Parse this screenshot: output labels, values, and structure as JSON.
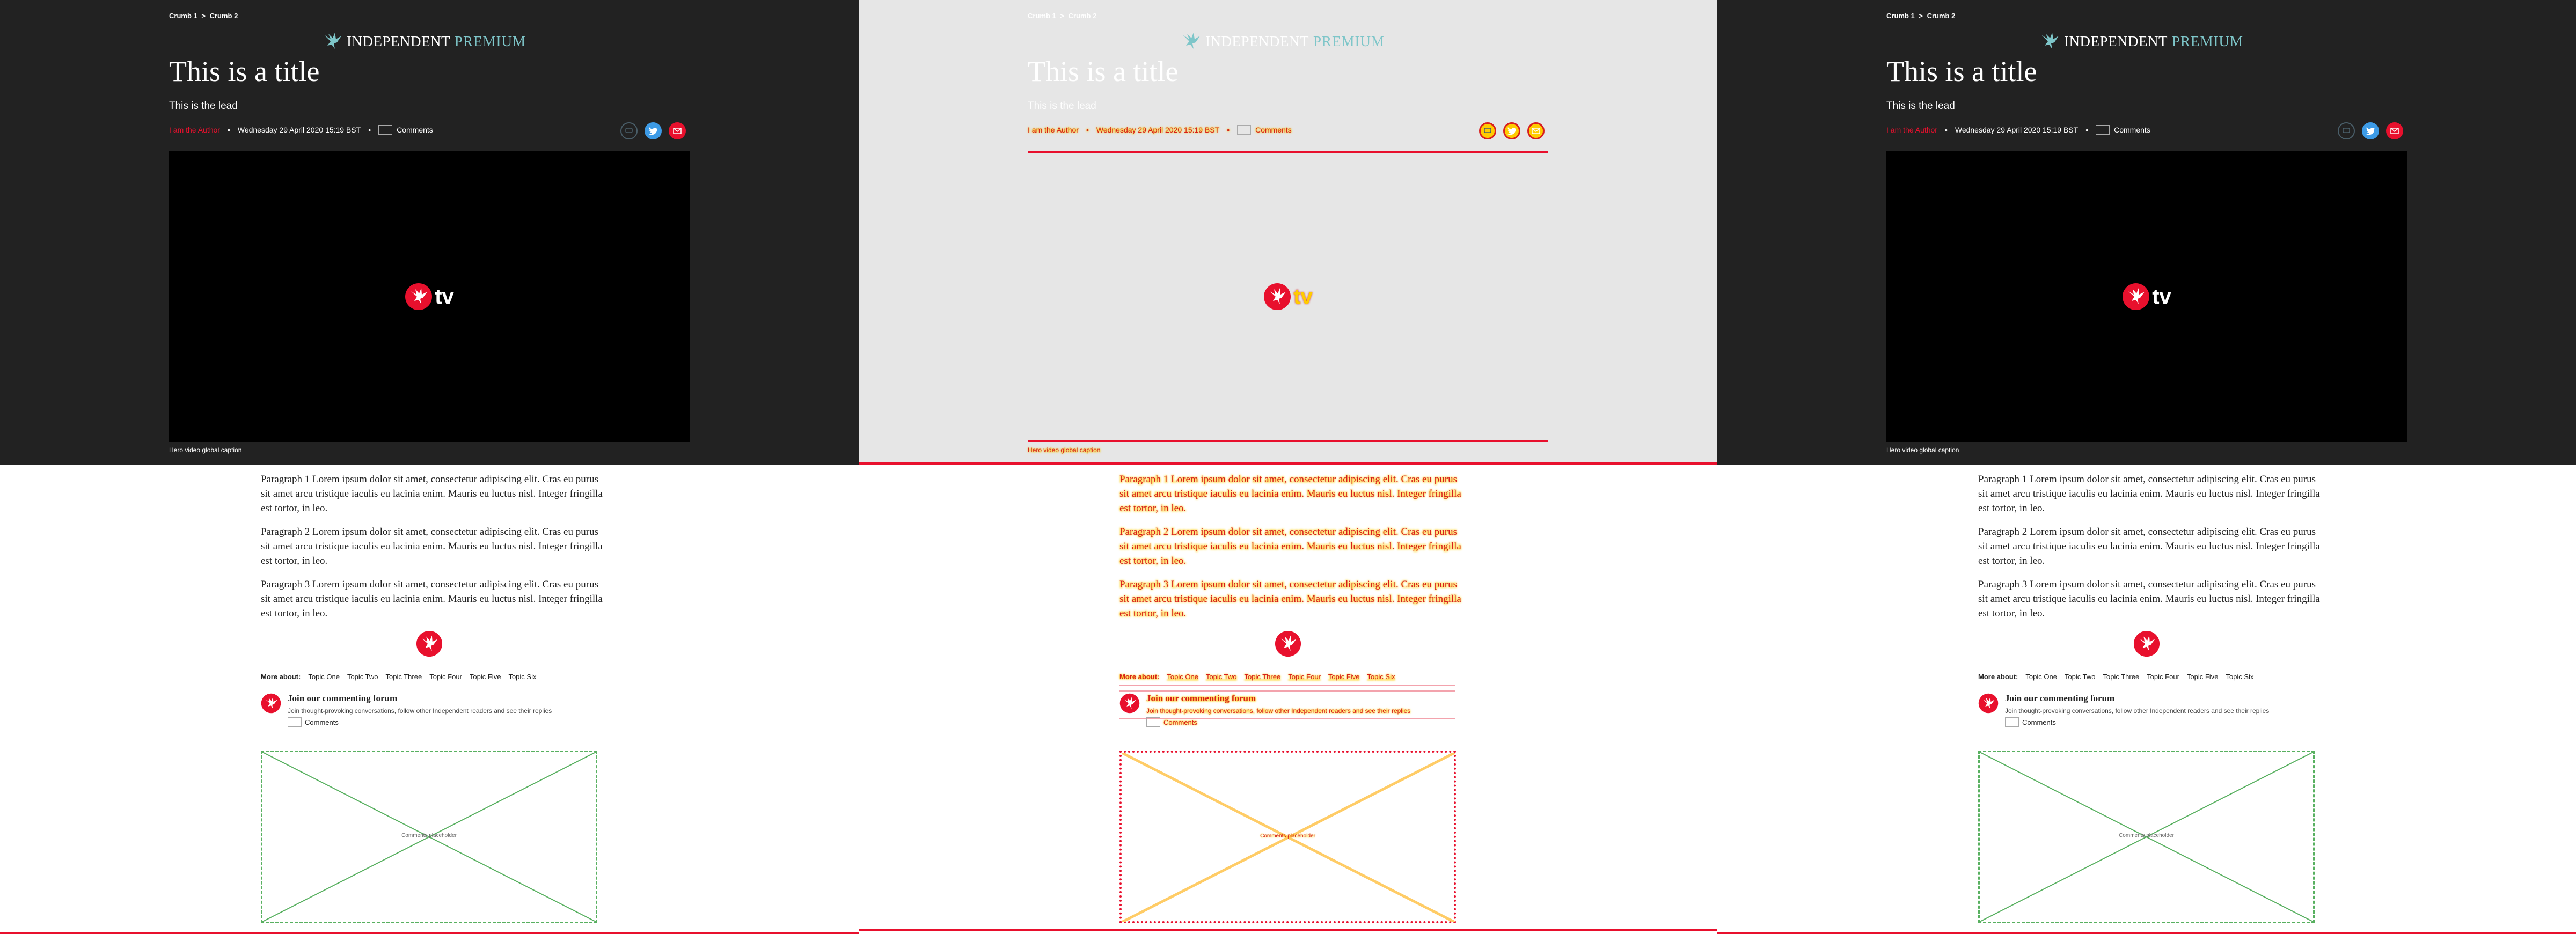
{
  "breadcrumb": {
    "crumb1": "Crumb 1",
    "separator": ">",
    "crumb2": "Crumb 2"
  },
  "brand": {
    "name": "INDEPENDENT",
    "tier": "PREMIUM",
    "icon": "eagle-icon"
  },
  "article": {
    "title": "This is a title",
    "lead": "This is the lead",
    "author": "I am the Author",
    "date": "Wednesday 29 April 2020 15:19 BST",
    "comments_label": "Comments"
  },
  "share": {
    "icons": [
      "comment-icon",
      "twitter-icon",
      "email-icon"
    ]
  },
  "video": {
    "logo_text": "tv",
    "caption": "Hero video global caption"
  },
  "body": {
    "paragraphs": [
      "Paragraph 1 Lorem ipsum dolor sit amet, consectetur adipiscing elit. Cras eu purus sit amet arcu tristique iaculis eu lacinia enim. Mauris eu luctus nisl. Integer fringilla est tortor, in leo.",
      "Paragraph 2 Lorem ipsum dolor sit amet, consectetur adipiscing elit. Cras eu purus sit amet arcu tristique iaculis eu lacinia enim. Mauris eu luctus nisl. Integer fringilla est tortor, in leo.",
      "Paragraph 3 Lorem ipsum dolor sit amet, consectetur adipiscing elit. Cras eu purus sit amet arcu tristique iaculis eu lacinia enim. Mauris eu luctus nisl. Integer fringilla est tortor, in leo."
    ]
  },
  "more_about": {
    "label": "More about:",
    "topics": [
      "Topic One",
      "Topic Two",
      "Topic Three",
      "Topic Four",
      "Topic Five",
      "Topic Six"
    ]
  },
  "forum": {
    "title": "Join our commenting forum",
    "subtitle": "Join thought-provoking conversations, follow other Independent readers and see their replies",
    "comments_label": "Comments"
  },
  "placeholder": {
    "label": "Comments placeholder"
  },
  "colors": {
    "hero_bg": "#222222",
    "overlay_bg": "#e6e6e6",
    "accent_red": "#e8102d",
    "premium_teal": "#7ec6c9",
    "twitter_blue": "#3d9be6",
    "placeholder_green": "#58b060",
    "debug_yellow": "#ffcc00"
  }
}
